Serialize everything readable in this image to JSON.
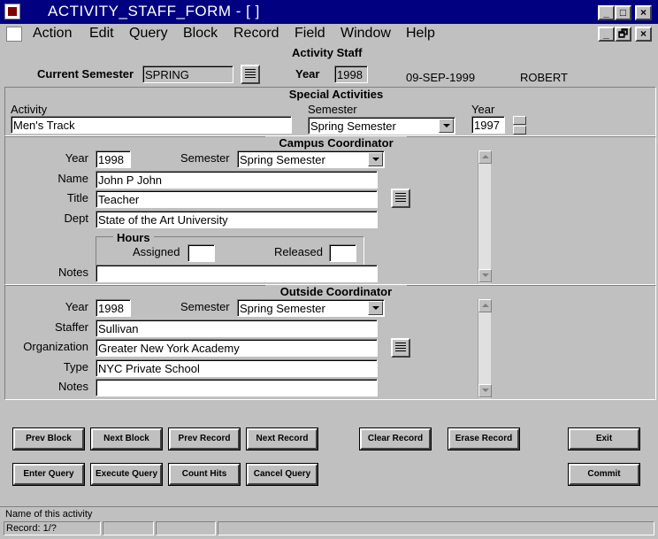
{
  "window": {
    "title": "ACTIVITY_STAFF_FORM - [ ]",
    "minimize": "_",
    "maximize": "□",
    "close": "×"
  },
  "menu": {
    "items": [
      "Action",
      "Edit",
      "Query",
      "Block",
      "Record",
      "Field",
      "Window",
      "Help"
    ],
    "mdi_minimize": "_",
    "mdi_restore": "🗗",
    "mdi_close": "×"
  },
  "form_title": "Activity Staff",
  "header": {
    "current_semester_label": "Current Semester",
    "current_semester_value": "SPRING",
    "year_label": "Year",
    "year_value": "1998",
    "date": "09-SEP-1999",
    "user": "ROBERT"
  },
  "special_activities": {
    "title": "Special Activities",
    "activity_label": "Activity",
    "activity_value": "Men's Track",
    "semester_label": "Semester",
    "semester_value": "Spring Semester",
    "year_label": "Year",
    "year_value": "1997"
  },
  "campus_coordinator": {
    "title": "Campus Coordinator",
    "year_label": "Year",
    "year_value": "1998",
    "semester_label": "Semester",
    "semester_value": "Spring Semester",
    "name_label": "Name",
    "name_value": "John P John",
    "title_label": "Title",
    "title_value": "Teacher",
    "dept_label": "Dept",
    "dept_value": "State of the Art University",
    "hours_label": "Hours",
    "assigned_label": "Assigned",
    "assigned_value": "",
    "released_label": "Released",
    "released_value": "",
    "notes_label": "Notes",
    "notes_value": ""
  },
  "outside_coordinator": {
    "title": "Outside Coordinator",
    "year_label": "Year",
    "year_value": "1998",
    "semester_label": "Semester",
    "semester_value": "Spring Semester",
    "staffer_label": "Staffer",
    "staffer_value": "Sullivan",
    "org_label": "Organization",
    "org_value": "Greater New York Academy",
    "type_label": "Type",
    "type_value": "NYC Private School",
    "notes_label": "Notes",
    "notes_value": ""
  },
  "buttons": {
    "prev_block": "Prev Block",
    "next_block": "Next Block",
    "prev_record": "Prev Record",
    "next_record": "Next Record",
    "clear_record": "Clear Record",
    "erase_record": "Erase Record",
    "exit": "Exit",
    "enter_query": "Enter Query",
    "execute_query": "Execute Query",
    "count_hits": "Count Hits",
    "cancel_query": "Cancel Query",
    "commit": "Commit"
  },
  "status": {
    "hint": "Name of this activity",
    "record": "Record: 1/?"
  }
}
